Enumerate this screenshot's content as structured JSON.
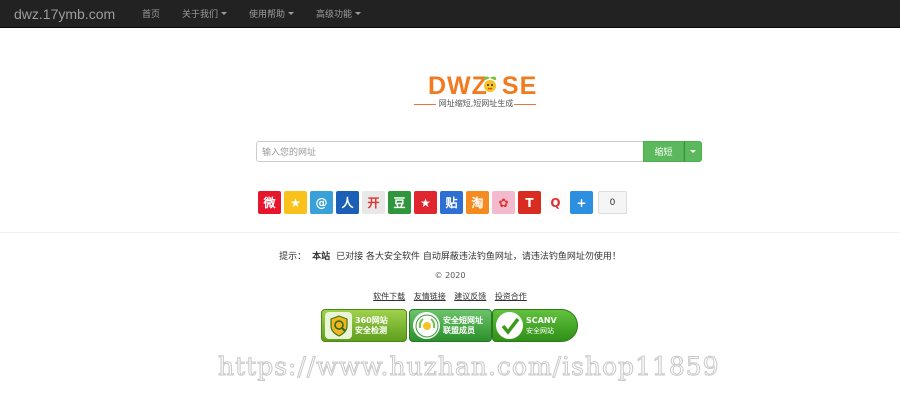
{
  "navbar": {
    "brand": "dwz.17ymb.com",
    "items": [
      {
        "label": "首页",
        "dropdown": false
      },
      {
        "label": "关于我们",
        "dropdown": true
      },
      {
        "label": "使用帮助",
        "dropdown": true
      },
      {
        "label": "高级功能",
        "dropdown": true
      }
    ]
  },
  "logo": {
    "text_left": "DWZ",
    "text_right": "SE",
    "tagline": "网址缩短,短网址生成"
  },
  "search": {
    "placeholder": "输入您的网址",
    "button_label": "缩短"
  },
  "share": {
    "icons": [
      {
        "name": "weibo-share-icon",
        "glyph": "微",
        "bg": "#e6162d"
      },
      {
        "name": "qzone-share-icon",
        "glyph": "★",
        "bg": "#f8c21b"
      },
      {
        "name": "tencent-weibo-share-icon",
        "glyph": "@",
        "bg": "#3aa0d8"
      },
      {
        "name": "renren-share-icon",
        "glyph": "人",
        "bg": "#1b5fb6"
      },
      {
        "name": "kaixin-share-icon",
        "glyph": "开",
        "bg": "#e8e8e8"
      },
      {
        "name": "douban-share-icon",
        "glyph": "豆",
        "bg": "#2f963d"
      },
      {
        "name": "star-share-icon",
        "glyph": "★",
        "bg": "#e0262e"
      },
      {
        "name": "tieba-share-icon",
        "glyph": "贴",
        "bg": "#2f6fd3"
      },
      {
        "name": "taobao-share-icon",
        "glyph": "淘",
        "bg": "#f58b1f"
      },
      {
        "name": "flower-share-icon",
        "glyph": "✿",
        "bg": "#f3b9cc"
      },
      {
        "name": "toutiao-share-icon",
        "glyph": "T",
        "bg": "#d72c1f"
      },
      {
        "name": "qq-share-icon",
        "glyph": "Q",
        "bg": "#fcfcfc"
      },
      {
        "name": "more-share-icon",
        "glyph": "+",
        "bg": "#2d8fe0"
      }
    ],
    "count": "0"
  },
  "footer": {
    "notice_prefix": "提示：",
    "notice_site": "本站",
    "notice_text": "已对接 各大安全软件 自动屏蔽违法钓鱼网址，请违法钓鱼网址勿使用！",
    "copyright": "© 2020",
    "links": [
      "软件下载",
      "友情链接",
      "建议反馈",
      "投资合作"
    ]
  },
  "badges": [
    {
      "line1": "360网站",
      "line2": "安全检测"
    },
    {
      "line1": "安全短网址",
      "line2": "联盟成员"
    },
    {
      "line1": "SCANV",
      "line2": "安全网站"
    }
  ],
  "watermark": "https://www.huzhan.com/ishop11859",
  "colors": {
    "navbar_bg": "#222222",
    "logo_orange": "#f27b1f",
    "button_green": "#5cb85c"
  }
}
